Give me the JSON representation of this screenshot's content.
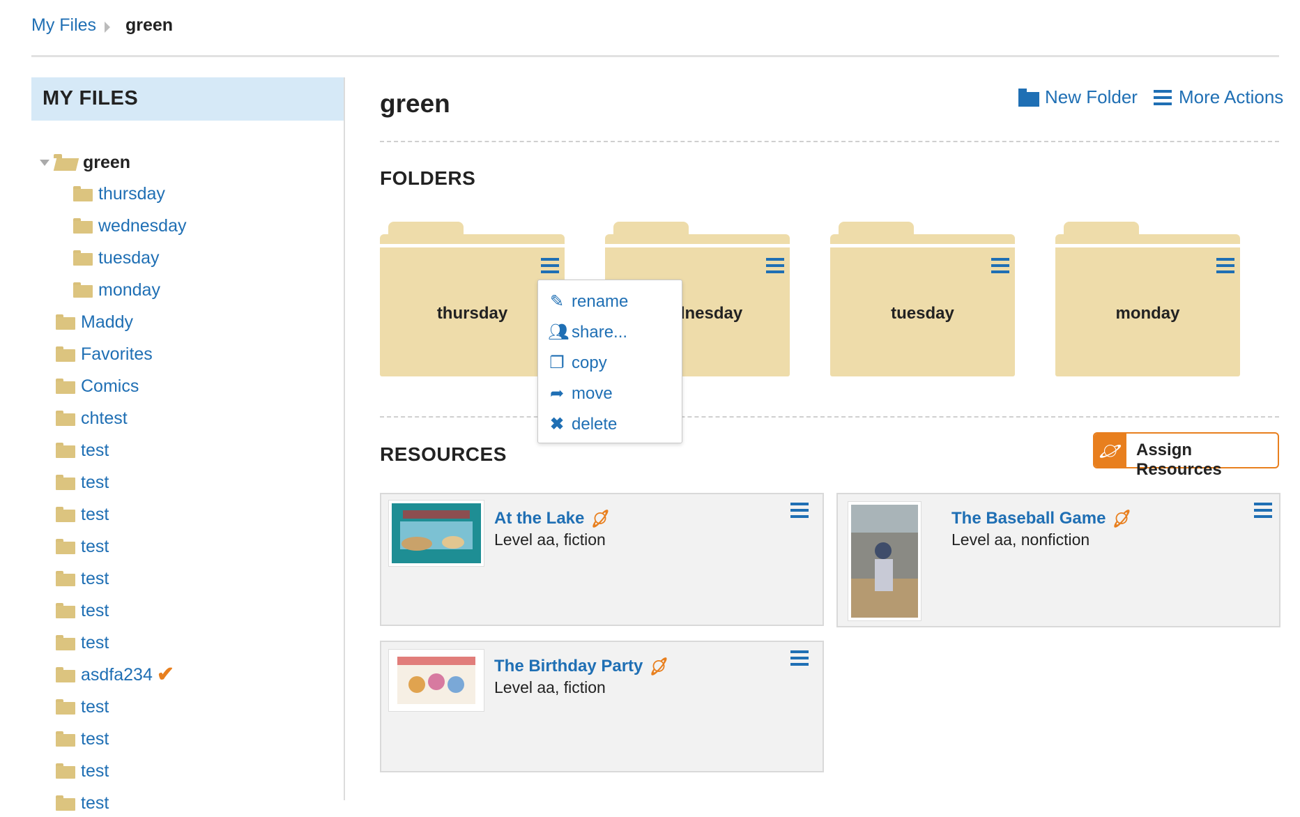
{
  "breadcrumb": {
    "root": "My Files",
    "current": "green"
  },
  "sidebar": {
    "title": "MY FILES",
    "root": "green",
    "subfolders": [
      "thursday",
      "wednesday",
      "tuesday",
      "monday"
    ],
    "items": [
      "Maddy",
      "Favorites",
      "Comics",
      "chtest",
      "test",
      "test",
      "test",
      "test",
      "test",
      "test",
      "test",
      "asdfa234",
      "test",
      "test",
      "test",
      "test"
    ]
  },
  "main": {
    "title": "green",
    "new_folder": "New Folder",
    "more_actions": "More Actions",
    "folders_heading": "FOLDERS",
    "resources_heading": "RESOURCES",
    "assign_label": "Assign Resources"
  },
  "folders": [
    "thursday",
    "wednesday",
    "tuesday",
    "monday"
  ],
  "context_menu": [
    "rename",
    "share...",
    "copy",
    "move",
    "delete"
  ],
  "resources": [
    {
      "title": "At the Lake",
      "subtitle": "Level aa, fiction"
    },
    {
      "title": "The Baseball Game",
      "subtitle": "Level aa, nonfiction"
    },
    {
      "title": "The Birthday Party",
      "subtitle": "Level aa, fiction"
    }
  ],
  "colors": {
    "link": "#1f6fb4",
    "folder": "#eedcaa",
    "accent": "#e87f1e",
    "sidebar_head": "#d6e9f7"
  },
  "icons": {
    "assign": "planet-icon",
    "menu": "hamburger-icon",
    "checkmark": "check-icon"
  }
}
